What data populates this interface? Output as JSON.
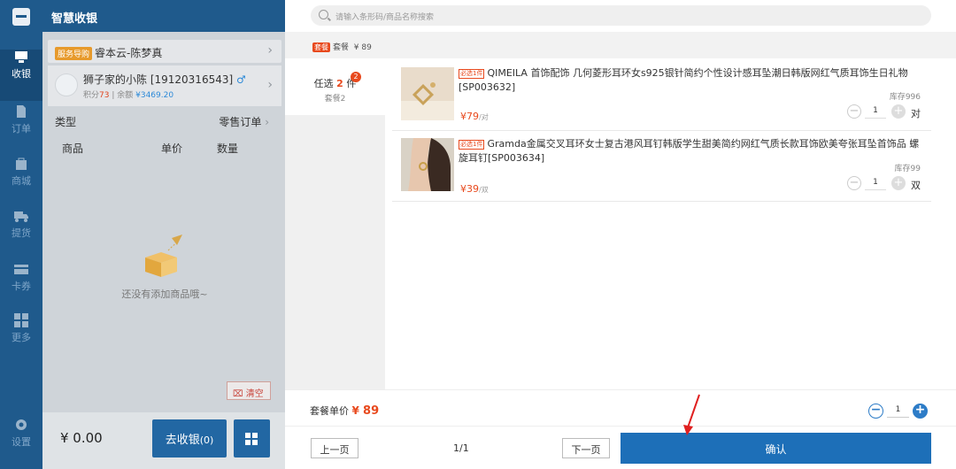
{
  "app": {
    "title": "智慧收银"
  },
  "nav": {
    "items": [
      {
        "label": "收银",
        "icon": "cashier-icon"
      },
      {
        "label": "订单",
        "icon": "order-icon"
      },
      {
        "label": "商城",
        "icon": "mall-icon"
      },
      {
        "label": "提货",
        "icon": "delivery-truck-icon"
      },
      {
        "label": "卡券",
        "icon": "card-icon"
      },
      {
        "label": "更多",
        "icon": "grid-more-icon"
      },
      {
        "label": "设置",
        "icon": "gear-icon"
      }
    ]
  },
  "left": {
    "guide_tag": "服务导购",
    "guide_name": "睿本云-陈梦真",
    "member_name": "狮子家的小陈 [19120316543]",
    "member_gender": "♂",
    "points_label": "积分",
    "points": "73",
    "balance_label": "余额",
    "balance": "¥3469.20",
    "type_label": "类型",
    "type_value": "零售订单",
    "col_goods": "商品",
    "col_price": "单价",
    "col_qty": "数量",
    "empty_text": "还没有添加商品哦~",
    "clear_label": "清空",
    "total": "¥ 0.00",
    "checkout_label": "去收银",
    "checkout_count": "(0)"
  },
  "modal": {
    "search_placeholder": "请输入条形码/商品名称搜索",
    "package_tag": "套餐",
    "package_name": "套餐",
    "package_price": "¥ 89",
    "side": {
      "prefix": "任选",
      "count": "2",
      "suffix": "件",
      "sub": "套餐2",
      "badge": "2"
    },
    "products": [
      {
        "tag": "必选1件",
        "title": "QIMEILA 首饰配饰 几何菱形耳环女s925银针简约个性设计感耳坠潮日韩版网红气质耳饰生日礼物[SP003632]",
        "price": "¥79",
        "unit_price": "/对",
        "stock": "库存996",
        "qty": "1",
        "unit": "对"
      },
      {
        "tag": "必选1件",
        "title": "Gramda金属交叉耳环女士复古港风耳钉韩版学生甜美简约网红气质长款耳饰欧美夸张耳坠首饰品 螺旋耳钉[SP003634]",
        "price": "¥39",
        "unit_price": "/双",
        "stock": "库存99",
        "qty": "1",
        "unit": "双"
      }
    ],
    "summary_label": "套餐单价",
    "summary_currency": "¥",
    "summary_price": "89",
    "summary_qty": "1",
    "prev_label": "上一页",
    "page": "1/1",
    "next_label": "下一页",
    "confirm_label": "确认"
  },
  "colors": {
    "nav": "#1f5a8c",
    "accent": "#1d6fb8",
    "price": "#e8491d"
  }
}
